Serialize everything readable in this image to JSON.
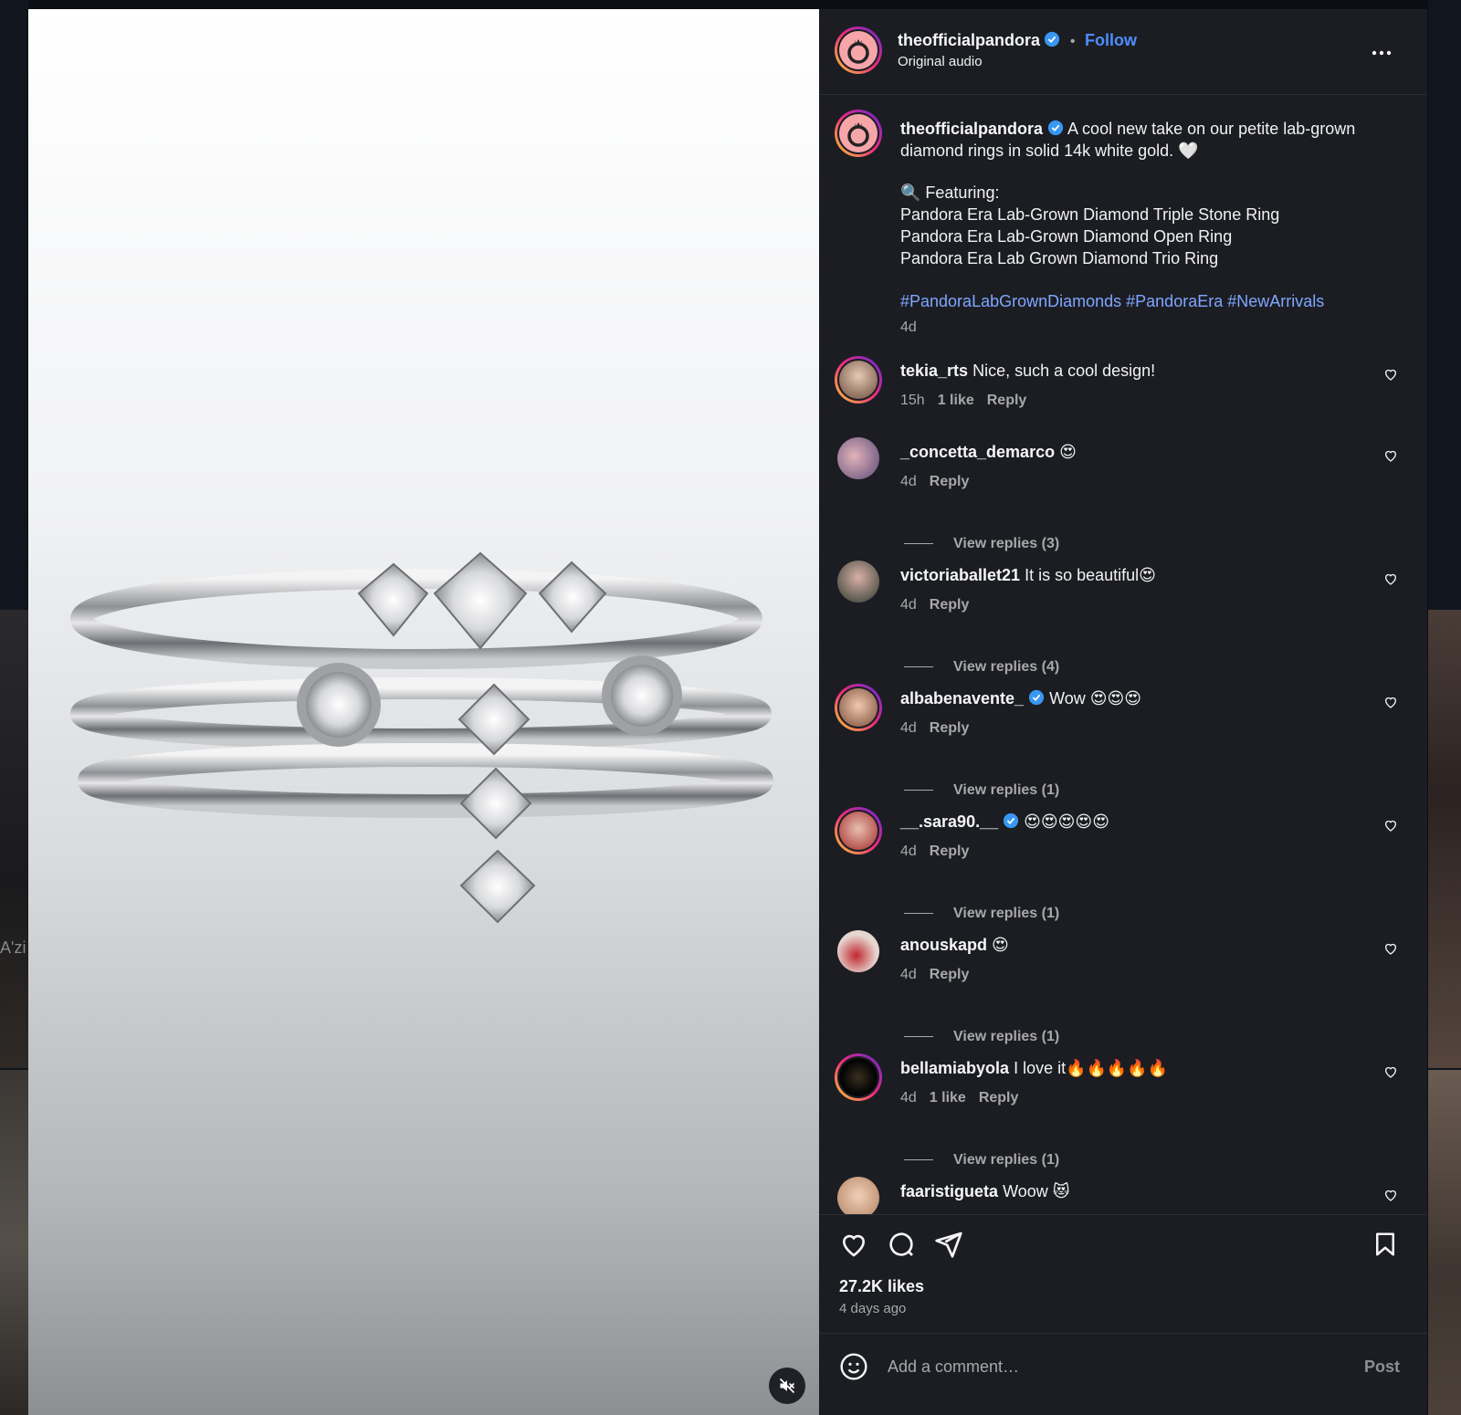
{
  "background": {
    "left_tile_text": "A'zi"
  },
  "post": {
    "username": "theofficialpandora",
    "follow_label": "Follow",
    "separator": "•",
    "audio": "Original audio",
    "caption": {
      "username": "theofficialpandora",
      "text": "A cool new take on our petite lab-grown diamond rings in solid 14k white gold. 🤍",
      "featuring_label": "🔍 Featuring:",
      "items": [
        "Pandora Era Lab-Grown Diamond Triple Stone Ring",
        "Pandora Era Lab-Grown Diamond Open Ring",
        "Pandora Era Lab Grown Diamond Trio Ring"
      ],
      "hashtags": "#PandoraLabGrownDiamonds #PandoraEra #NewArrivals",
      "time": "4d"
    },
    "likes": "27.2K likes",
    "posted": "4 days ago",
    "comment_placeholder": "Add a comment…",
    "post_button": "Post"
  },
  "comments": [
    {
      "user": "tekia_rts",
      "text": "Nice, such a cool design!",
      "time": "15h",
      "likes": "1 like",
      "reply": "Reply",
      "view_replies": ""
    },
    {
      "user": "_concetta_demarco",
      "text": "😍",
      "time": "4d",
      "likes": "",
      "reply": "Reply",
      "view_replies": "View replies (3)"
    },
    {
      "user": "victoriaballet21",
      "text": "It is so beautiful😍",
      "time": "4d",
      "likes": "",
      "reply": "Reply",
      "view_replies": "View replies (4)"
    },
    {
      "user": "albabenavente_",
      "text": "Wow 😍😍😍",
      "time": "4d",
      "likes": "",
      "reply": "Reply",
      "view_replies": "View replies (1)",
      "verified": true
    },
    {
      "user": "__.sara90.__",
      "text": "😍😍😍😍😍",
      "time": "4d",
      "likes": "",
      "reply": "Reply",
      "view_replies": "View replies (1)",
      "verified": true
    },
    {
      "user": "anouskapd",
      "text": "😍",
      "time": "4d",
      "likes": "",
      "reply": "Reply",
      "view_replies": "View replies (1)"
    },
    {
      "user": "bellamiabyola",
      "text": "I love it🔥🔥🔥🔥🔥",
      "time": "4d",
      "likes": "1 like",
      "reply": "Reply",
      "view_replies": "View replies (1)"
    },
    {
      "user": "faaristigueta",
      "text": "Woow 😻",
      "time": "",
      "likes": "",
      "reply": "",
      "view_replies": ""
    }
  ],
  "colors": {
    "accent": "#4d8dff",
    "hashtag": "#7fa6ff",
    "panel": "#1b1d23"
  }
}
